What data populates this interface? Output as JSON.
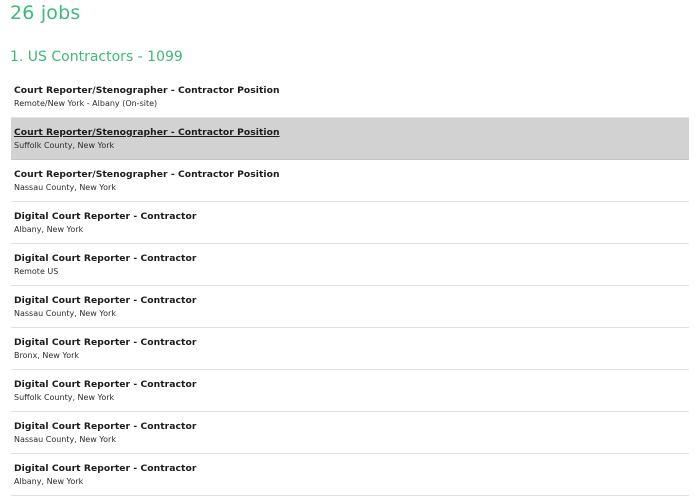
{
  "header": {
    "jobs_count": "26 jobs"
  },
  "section": {
    "title": "1. US Contractors - 1099"
  },
  "jobs": [
    {
      "title": "Court Reporter/Stenographer - Contractor Position",
      "location": "Remote/New York - Albany (On-site)",
      "highlighted": false
    },
    {
      "title": "Court Reporter/Stenographer - Contractor Position",
      "location": "Suffolk County, New York",
      "highlighted": true
    },
    {
      "title": "Court Reporter/Stenographer - Contractor Position",
      "location": "Nassau County, New York",
      "highlighted": false
    },
    {
      "title": "Digital Court Reporter - Contractor",
      "location": "Albany, New York",
      "highlighted": false
    },
    {
      "title": "Digital Court Reporter - Contractor",
      "location": "Remote US",
      "highlighted": false
    },
    {
      "title": "Digital Court Reporter - Contractor",
      "location": "Nassau County, New York",
      "highlighted": false
    },
    {
      "title": "Digital Court Reporter - Contractor",
      "location": "Bronx, New York",
      "highlighted": false
    },
    {
      "title": "Digital Court Reporter - Contractor",
      "location": "Suffolk County, New York",
      "highlighted": false
    },
    {
      "title": "Digital Court Reporter - Contractor",
      "location": "Nassau County, New York",
      "highlighted": false
    },
    {
      "title": "Digital Court Reporter - Contractor",
      "location": "Albany, New York",
      "highlighted": false
    }
  ]
}
